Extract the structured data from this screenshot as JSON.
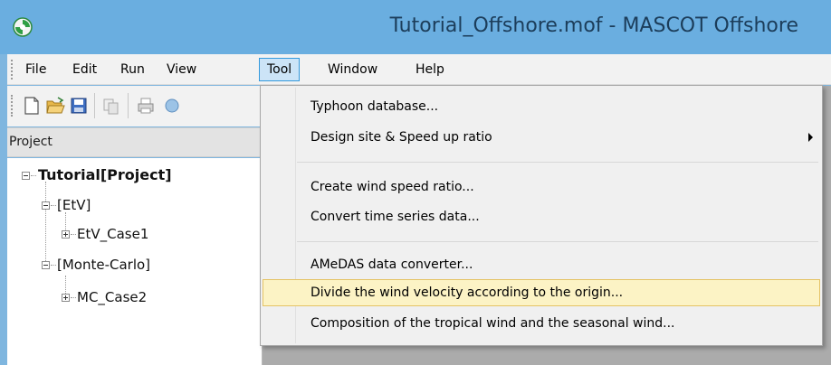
{
  "window": {
    "title": "Tutorial_Offshore.mof - MASCOT Offshore",
    "icon": "app-logo-icon",
    "titlebar_color": "#6aaee0"
  },
  "menubar": {
    "items": [
      {
        "label": "File"
      },
      {
        "label": "Edit"
      },
      {
        "label": "Run"
      },
      {
        "label": "View"
      },
      {
        "label": "Tool",
        "active": true
      },
      {
        "label": "Window"
      },
      {
        "label": "Help"
      }
    ]
  },
  "toolbar": {
    "icons": [
      "new-file-icon",
      "open-folder-icon",
      "save-icon",
      "copy-icon",
      "print-icon",
      "globe-icon"
    ]
  },
  "project_panel": {
    "header": "Project",
    "tree": [
      {
        "label": "Tutorial[Project]",
        "level": 0,
        "expanded": true
      },
      {
        "label": "[EtV]",
        "level": 1,
        "expanded": true
      },
      {
        "label": "EtV_Case1",
        "level": 2,
        "expanded": false
      },
      {
        "label": "[Monte-Carlo]",
        "level": 1,
        "expanded": true
      },
      {
        "label": "MC_Case2",
        "level": 2,
        "expanded": false
      }
    ]
  },
  "tool_menu": {
    "items": [
      {
        "label": "Typhoon database..."
      },
      {
        "label": "Design site & Speed up ratio",
        "submenu": true
      },
      {
        "label": "Create wind speed ratio..."
      },
      {
        "label": "Convert time series data..."
      },
      {
        "label": "AMeDAS data converter..."
      },
      {
        "label": "Divide the wind velocity according to the origin...",
        "highlighted": true
      },
      {
        "label": "Composition of the tropical wind and the seasonal wind..."
      }
    ],
    "highlight_color": "#fcf3c5"
  }
}
